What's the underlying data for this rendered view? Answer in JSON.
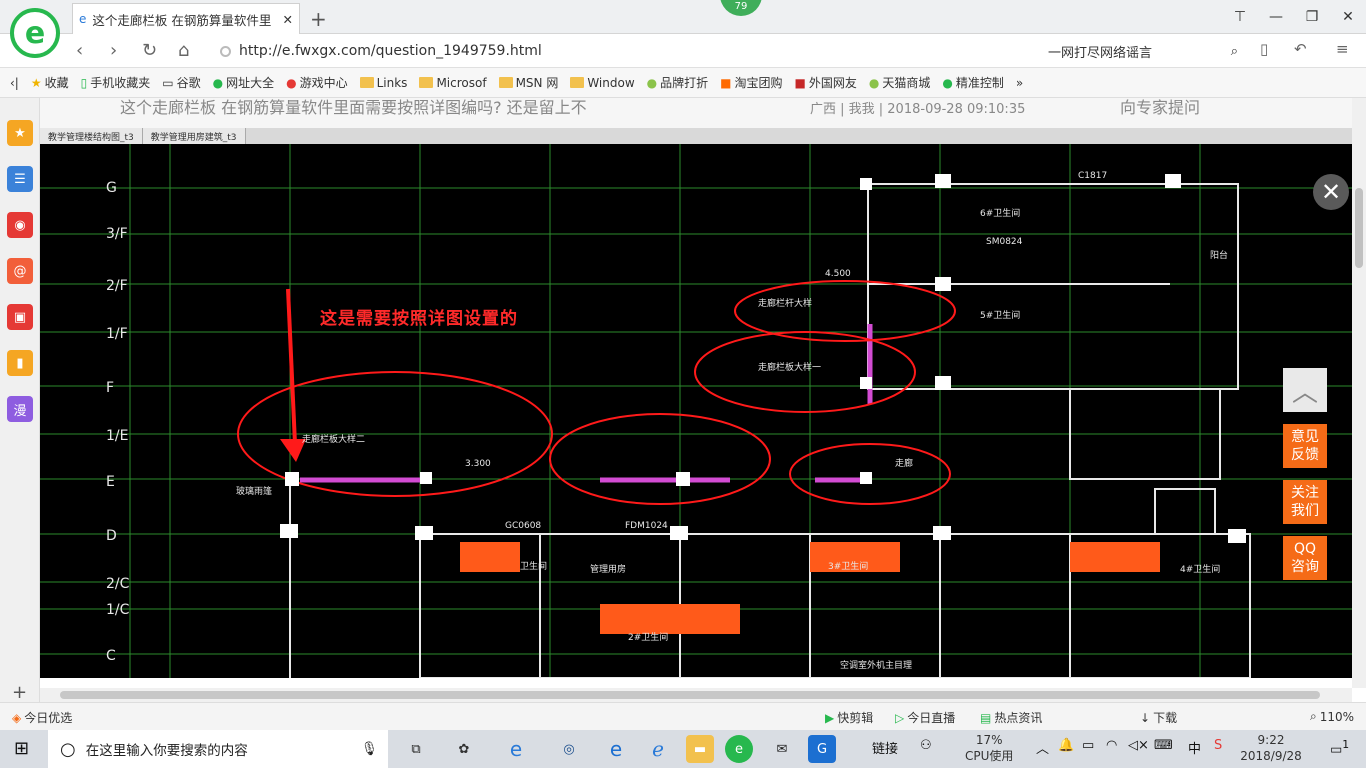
{
  "browser": {
    "tab_title": "这个走廊栏板 在钢筋算量软件里",
    "tab_icon": "e",
    "new_tab": "+",
    "badge": "79",
    "url": "http://e.fwxgx.com/question_1949759.html",
    "search_text": "一网打尽网络谣言",
    "window_buttons": [
      "⊤",
      "—",
      "❐",
      "✕"
    ]
  },
  "bookmarks": [
    {
      "label": "收藏",
      "icon": "star-icon"
    },
    {
      "label": "手机收藏夹",
      "icon": "phone-icon"
    },
    {
      "label": "谷歌",
      "icon": "page-icon"
    },
    {
      "label": "网址大全",
      "icon": "globe-icon"
    },
    {
      "label": "游戏中心",
      "icon": "game-icon"
    },
    {
      "label": "Links",
      "icon": "folder-icon"
    },
    {
      "label": "Microsof",
      "icon": "folder-icon"
    },
    {
      "label": "MSN 网",
      "icon": "folder-icon"
    },
    {
      "label": "Window",
      "icon": "folder-icon"
    },
    {
      "label": "品牌打折",
      "icon": "leaf-icon"
    },
    {
      "label": "淘宝团购",
      "icon": "taobao-icon"
    },
    {
      "label": "外国网友",
      "icon": "flag-icon"
    },
    {
      "label": "天猫商城",
      "icon": "leaf-icon"
    },
    {
      "label": "精准控制",
      "icon": "chat-icon"
    }
  ],
  "page_bg": {
    "question_text": "这个走廊栏板 在钢筋算量软件里面需要按照详图编吗? 还是留上不",
    "meta": "广西 | 我我 | 2018-09-28 09:10:35",
    "ask_expert": "向专家提问"
  },
  "cad": {
    "tabs": [
      "教学管理楼结构图_t3",
      "教学管理用房建筑_t3"
    ],
    "annotation": "这是需要按照详图设置的",
    "grid_labels": [
      "G",
      "3/F",
      "2/F",
      "1/F",
      "F",
      "1/E",
      "E",
      "D",
      "2/C",
      "1/C",
      "C"
    ],
    "labels": [
      "走廊栏杆大样",
      "走廊栏板大样一",
      "走廊栏板大样二",
      "走廊",
      "卫生间",
      "管理用房",
      "阳台",
      "2#卫生间",
      "3#卫生间",
      "4#卫生间",
      "5#卫生间",
      "6#卫生间",
      "空调室外机主目理",
      "玻璃雨篷",
      "FDM1024",
      "GC0608",
      "SM0824",
      "C1817",
      "3.300",
      "4.500"
    ]
  },
  "floating": {
    "top": "︿",
    "feedback": "意见反馈",
    "follow": "关注我们",
    "qq": "QQ咨询"
  },
  "status": {
    "today": "今日优选",
    "quick_clip": "快剪辑",
    "live": "今日直播",
    "news": "热点资讯",
    "download": "下载",
    "zoom": "110%"
  },
  "taskbar": {
    "search_placeholder": "在这里输入你要搜索的内容",
    "link": "链接",
    "cpu_pct": "17%",
    "cpu_label": "CPU使用",
    "ime": "中",
    "time": "9:22",
    "date": "2018/9/28",
    "notif": "1"
  },
  "colors": {
    "accent": "#27b84e",
    "float_orange": "#f56b17",
    "cad_bg": "#000000",
    "annotation_red": "#ff2a2a"
  }
}
